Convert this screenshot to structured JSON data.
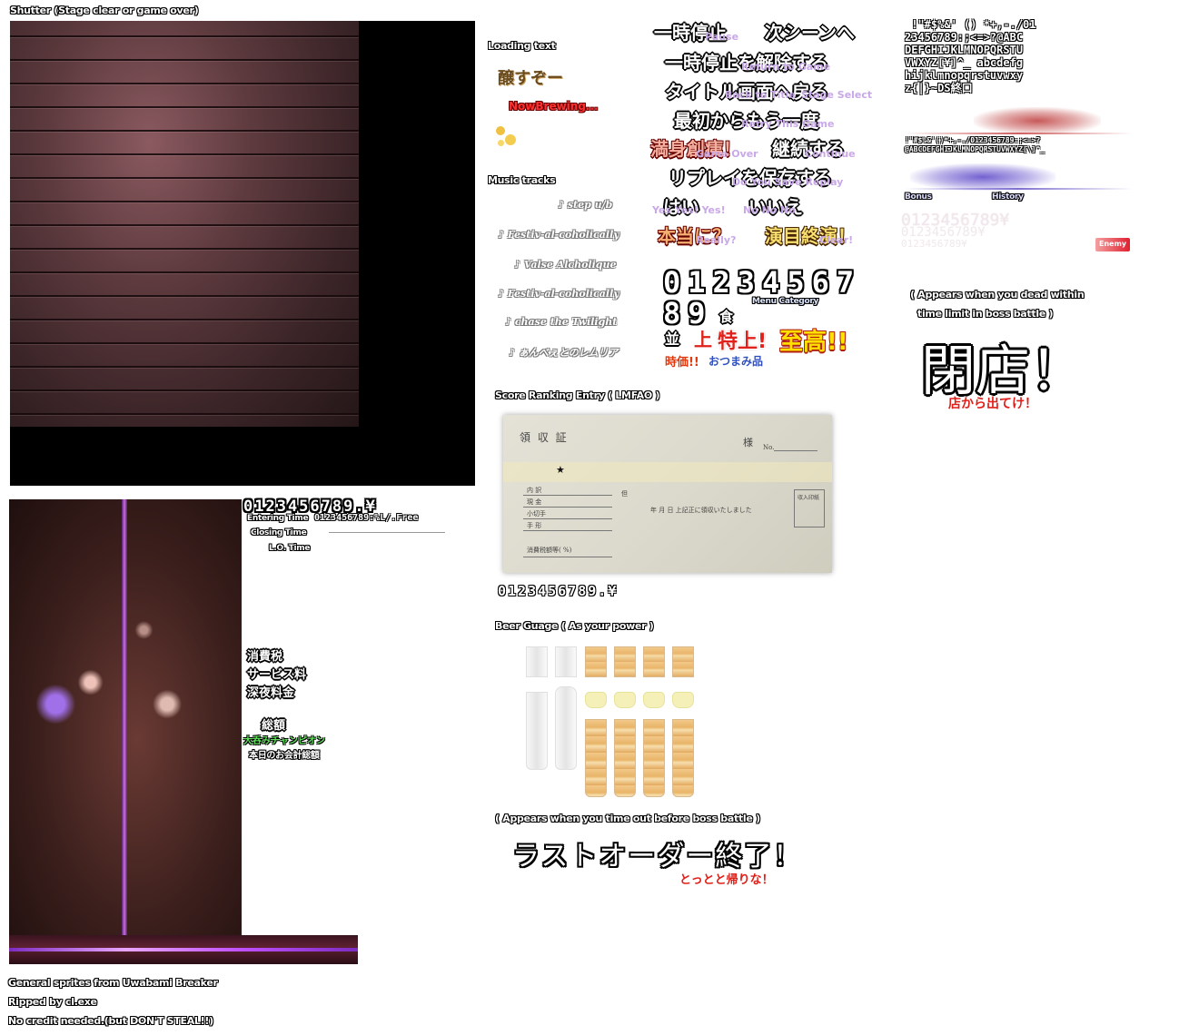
{
  "sections": {
    "shutter": "Shutter (Stage clear or game over)",
    "loading": "Loading text",
    "music": "Music tracks",
    "score_entry": "Score Ranking Entry  ( LMFAO )",
    "beer": "Beer Guage ( As your power )",
    "timeout_note": "( Appears when you time out before boss battle )",
    "dead_note_1": "( Appears when you dead within",
    "dead_note_2": "time limit in boss battle )"
  },
  "credits": {
    "line1": "General sprites from Uwabami Breaker",
    "line2": "Ripped by cl.exe",
    "line3": "No credit needed.(but DON'T STEAL!!)"
  },
  "loading": {
    "jp": "醸すぞー",
    "en": "NowBrewing..."
  },
  "tracks": [
    "♪ step u/b",
    "♪ Festiv-al-coholically",
    "♪ Valse Alcholique",
    "♪ Festiv-al-coholically",
    "♪ chase the Twilight",
    "♪ ぁんべぇとのレムリア"
  ],
  "pause_menu": {
    "pause": "一時停止",
    "pause_en": "Pause",
    "next_scene": "次シーンへ",
    "resume": "一時停止を解除する",
    "resume_en": "Return to Game",
    "title": "タイトル画面へ戻る",
    "title_en": "Back to Title",
    "title_en2": "Stage Select",
    "retry": "最初からもう一度",
    "retry_en": "Retry This Game",
    "satisfied": "満身創痍！",
    "satisfied_en": "Game Over",
    "continue": "継続する",
    "continue_en": "Continue",
    "save_replay": "リプレイを保存する",
    "save_replay_en": "Do You Save Replay",
    "yes": "はい",
    "yes_en": "Yes Yes! Yes!",
    "no": "いいえ",
    "no_en": "No No No",
    "really": "本当に？",
    "really_en": "Really?",
    "performance_end": "演目終演！",
    "performance_en": "Clear!"
  },
  "score_digits": {
    "row1": "01234567",
    "row2": "89",
    "food": "食",
    "menu_category": "Menu Category",
    "nami": "並",
    "jo": "上",
    "tokujo": "特上!",
    "shiko": "至高!!",
    "jika": "時価!!",
    "otsumami": "おつまみ品"
  },
  "font_sheet": {
    "line1": " !\"#$%&' () *+,-./01",
    "line2": "23456789:;<=>?@ABC",
    "line3": "DEFGHIJKLMNOPQRSTU",
    "line4": "VWXYZ[¥]^_ abcdefg",
    "line5": "hijklmnopqrstuvwxy",
    "line6": "z{|}~DS終口",
    "small_line1": "!\"#$%&'()*+,-./0123456789:;<=>?",
    "small_line2": "@ABCDEFGHIJKLMNOPQRSTUVWXYZ[\\]^_",
    "bonus": "Bonus",
    "history": "History",
    "enemy": "Enemy",
    "ghost_digits": "0123456789¥"
  },
  "closing": {
    "heitan": "閉店！",
    "get_out": "店から出てけ！"
  },
  "last_order": {
    "text": "ラストオーダー終了！",
    "go_home": "とっとと帰りな！"
  },
  "bar_info": {
    "digits": "0123456789.¥",
    "entering": "Entering Time",
    "entering_digits": "0123456789:%L/.Free",
    "closing": "Closing Time",
    "lo": "L.O. Time",
    "tax": "消費税",
    "service": "サービス料",
    "late_night": "深夜料金",
    "total": "総額",
    "champion": "大呑みチャンピオン",
    "today_total": "本日のお会計総額"
  },
  "receipt": {
    "title": "領 収 証",
    "sama": "様",
    "no": "No.",
    "star": "★",
    "uchiwake": "内 訳",
    "genkin": "現 金",
    "kogitte": "小切手",
    "tegata": "手 形",
    "tax_label": "消費税額等(  %)",
    "date": "年   月   日   上記正に領収いたしました",
    "yen": "但",
    "stamp": "収入印紙",
    "digits": "0123456789.¥"
  },
  "colors": {
    "accent_red": "#e0201a",
    "accent_yellow": "#ffe000",
    "accent_purple": "#c9a8e8",
    "beer": "#e8b468"
  }
}
